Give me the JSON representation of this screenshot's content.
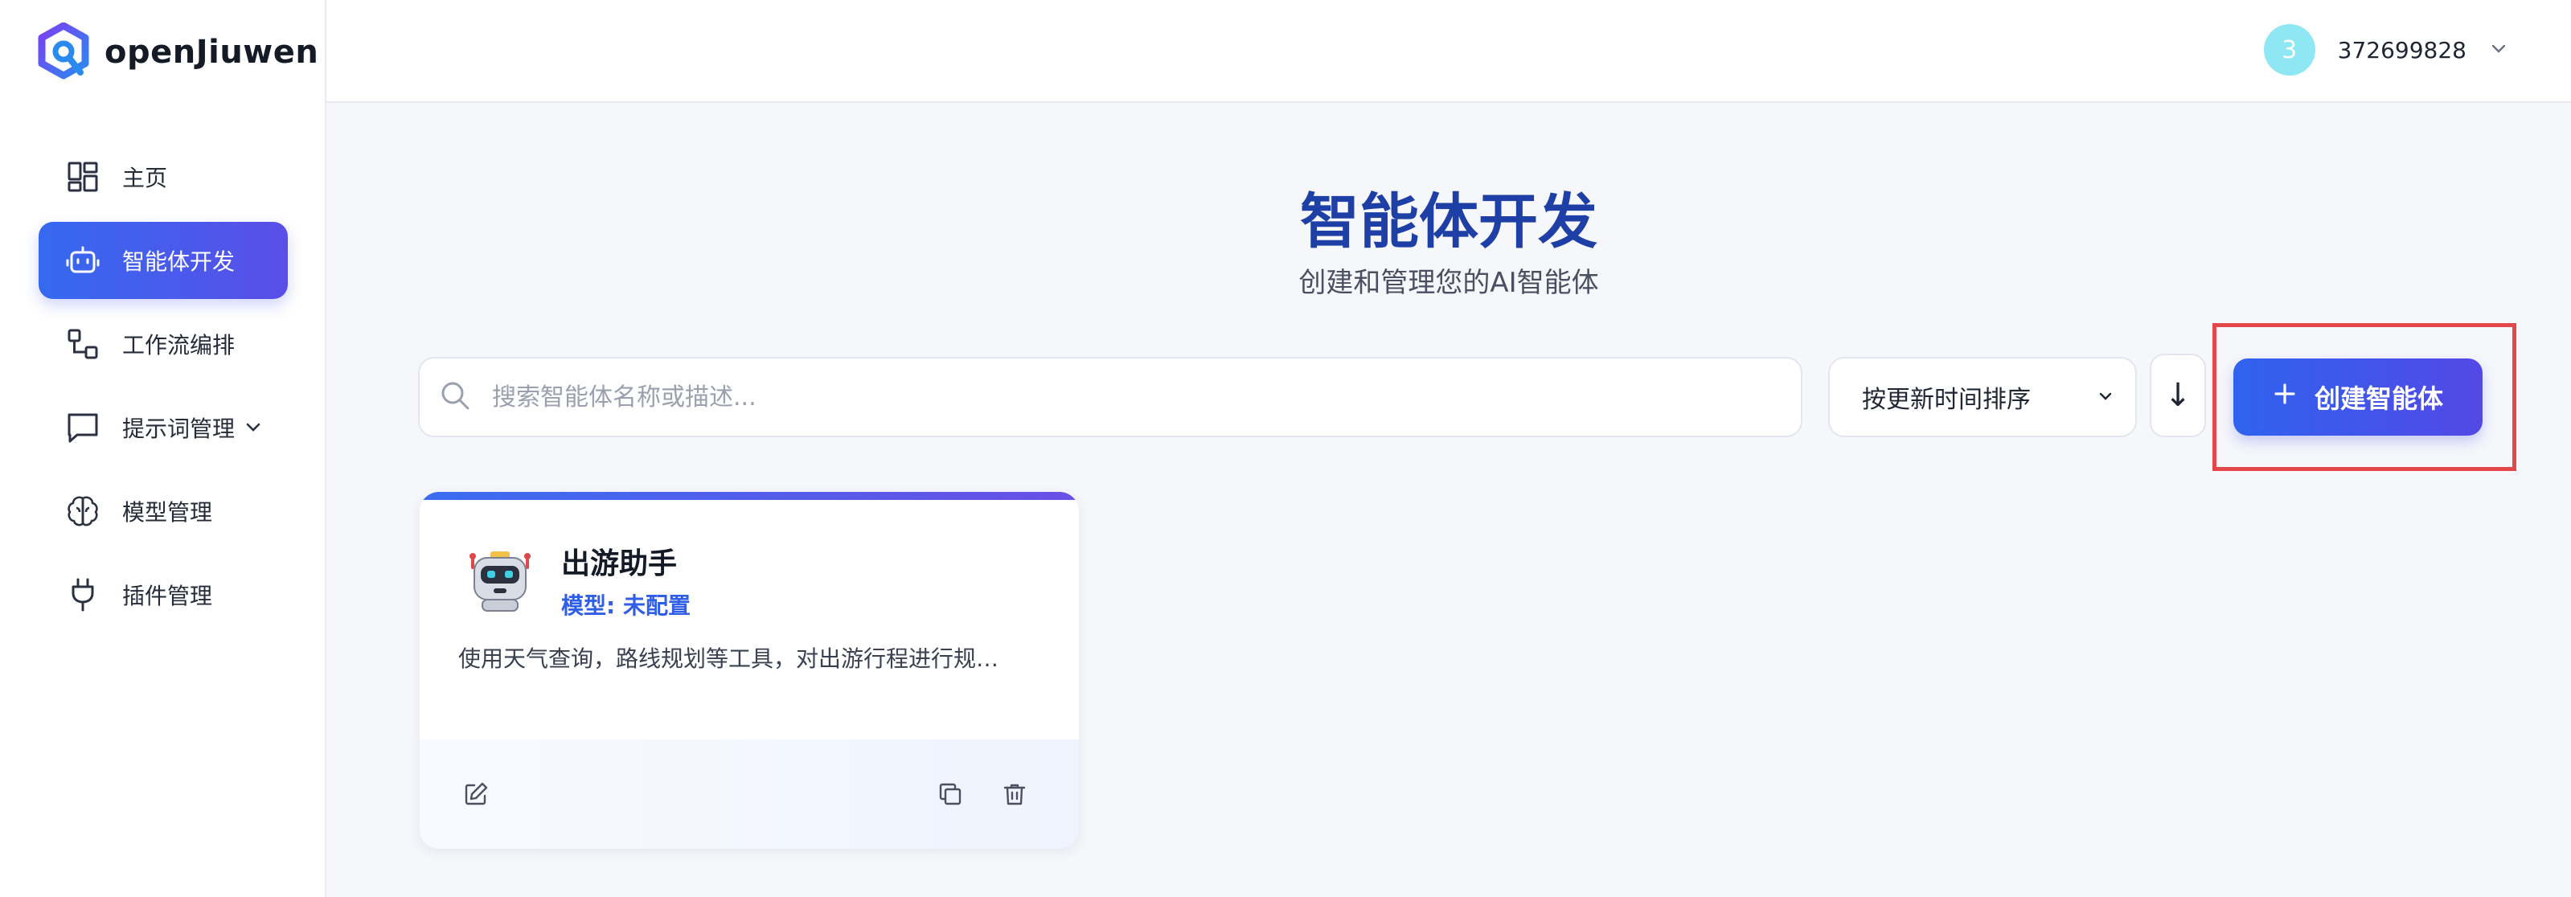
{
  "app": {
    "name": "openJiuwen",
    "brand_color": "#3569f0",
    "accent_gradient_end": "#5a4ee8"
  },
  "sidebar": {
    "items": [
      {
        "label": "主页",
        "icon": "dashboard-icon",
        "active": false
      },
      {
        "label": "智能体开发",
        "icon": "robot-icon",
        "active": true
      },
      {
        "label": "工作流编排",
        "icon": "workflow-icon",
        "active": false
      },
      {
        "label": "提示词管理",
        "icon": "chat-icon",
        "active": false,
        "has_submenu": true
      },
      {
        "label": "模型管理",
        "icon": "brain-icon",
        "active": false
      },
      {
        "label": "插件管理",
        "icon": "plug-icon",
        "active": false
      }
    ]
  },
  "header": {
    "user": {
      "avatar_text": "3",
      "avatar_color": "#8ee7f2",
      "name": "372699828"
    }
  },
  "main": {
    "title": "智能体开发",
    "subtitle": "创建和管理您的AI智能体",
    "search": {
      "placeholder": "搜索智能体名称或描述...",
      "value": ""
    },
    "sort": {
      "selected": "按更新时间排序",
      "direction_symbol": "↓"
    },
    "create_button": {
      "label": "创建智能体"
    },
    "agents": [
      {
        "name": "出游助手",
        "model": "模型: 未配置",
        "description": "使用天气查询，路线规划等工具，对出游行程进行规…",
        "icon": "robot-avatar-icon"
      }
    ]
  },
  "highlight_color": "#e4474a"
}
